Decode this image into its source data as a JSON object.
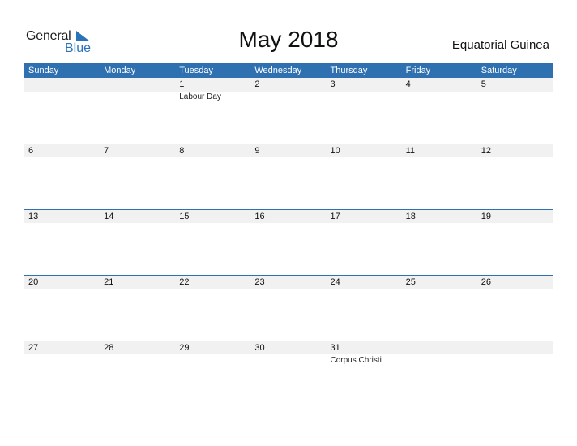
{
  "logo": {
    "line1": "General",
    "line2": "Blue",
    "brand_color": "#2a73b8"
  },
  "title": "May 2018",
  "country": "Equatorial Guinea",
  "colors": {
    "header_bg": "#2e70b0",
    "date_row_bg": "#f1f1f1"
  },
  "weekdays": [
    "Sunday",
    "Monday",
    "Tuesday",
    "Wednesday",
    "Thursday",
    "Friday",
    "Saturday"
  ],
  "weeks": [
    {
      "days": [
        {
          "num": "",
          "holiday": ""
        },
        {
          "num": "",
          "holiday": ""
        },
        {
          "num": "1",
          "holiday": "Labour Day"
        },
        {
          "num": "2",
          "holiday": ""
        },
        {
          "num": "3",
          "holiday": ""
        },
        {
          "num": "4",
          "holiday": ""
        },
        {
          "num": "5",
          "holiday": ""
        }
      ]
    },
    {
      "days": [
        {
          "num": "6",
          "holiday": ""
        },
        {
          "num": "7",
          "holiday": ""
        },
        {
          "num": "8",
          "holiday": ""
        },
        {
          "num": "9",
          "holiday": ""
        },
        {
          "num": "10",
          "holiday": ""
        },
        {
          "num": "11",
          "holiday": ""
        },
        {
          "num": "12",
          "holiday": ""
        }
      ]
    },
    {
      "days": [
        {
          "num": "13",
          "holiday": ""
        },
        {
          "num": "14",
          "holiday": ""
        },
        {
          "num": "15",
          "holiday": ""
        },
        {
          "num": "16",
          "holiday": ""
        },
        {
          "num": "17",
          "holiday": ""
        },
        {
          "num": "18",
          "holiday": ""
        },
        {
          "num": "19",
          "holiday": ""
        }
      ]
    },
    {
      "days": [
        {
          "num": "20",
          "holiday": ""
        },
        {
          "num": "21",
          "holiday": ""
        },
        {
          "num": "22",
          "holiday": ""
        },
        {
          "num": "23",
          "holiday": ""
        },
        {
          "num": "24",
          "holiday": ""
        },
        {
          "num": "25",
          "holiday": ""
        },
        {
          "num": "26",
          "holiday": ""
        }
      ]
    },
    {
      "days": [
        {
          "num": "27",
          "holiday": ""
        },
        {
          "num": "28",
          "holiday": ""
        },
        {
          "num": "29",
          "holiday": ""
        },
        {
          "num": "30",
          "holiday": ""
        },
        {
          "num": "31",
          "holiday": "Corpus Christi"
        },
        {
          "num": "",
          "holiday": ""
        },
        {
          "num": "",
          "holiday": ""
        }
      ]
    }
  ]
}
